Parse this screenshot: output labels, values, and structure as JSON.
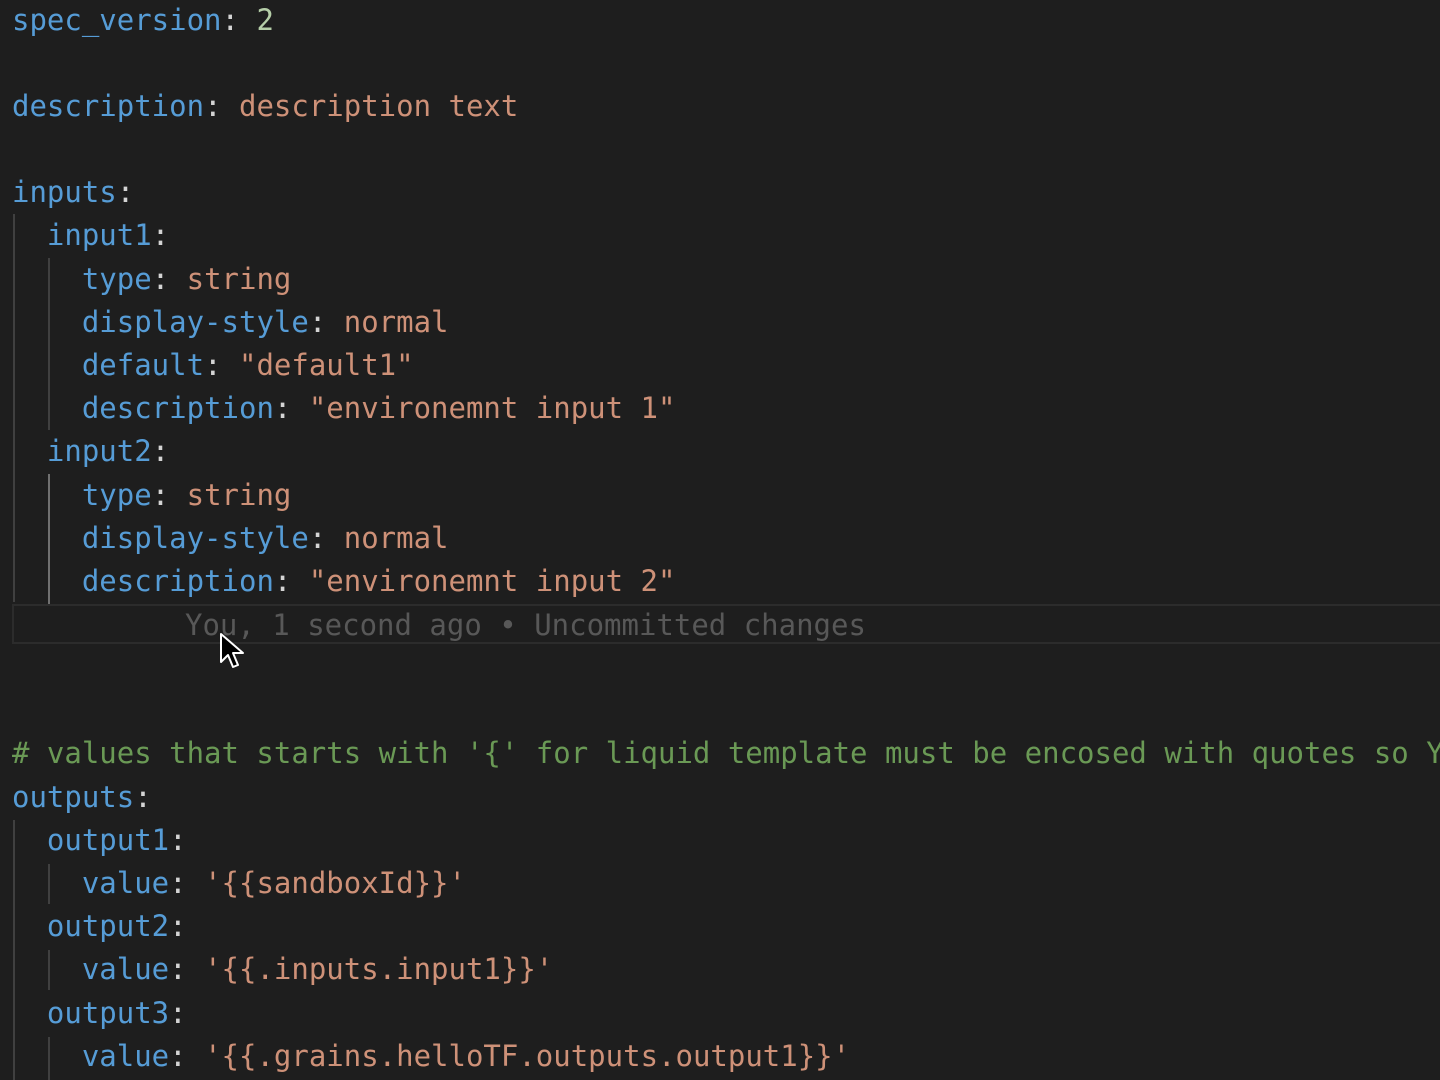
{
  "editor": {
    "language": "yaml",
    "lines": {
      "spec_version": {
        "key": "spec_version",
        "value": "2"
      },
      "description": {
        "key": "description",
        "value": "description text"
      },
      "inputs": {
        "key": "inputs"
      },
      "input1": {
        "key": "input1",
        "type": {
          "key": "type",
          "value": "string"
        },
        "display_style": {
          "key": "display-style",
          "value": "normal"
        },
        "default": {
          "key": "default",
          "value": "\"default1\""
        },
        "description": {
          "key": "description",
          "value": "\"environemnt input 1\""
        }
      },
      "input2": {
        "key": "input2",
        "type": {
          "key": "type",
          "value": "string"
        },
        "display_style": {
          "key": "display-style",
          "value": "normal"
        },
        "description": {
          "key": "description",
          "value": "\"environemnt input 2\""
        }
      },
      "comment": "# values that starts with '{' for liquid template must be encosed with quotes so YAML",
      "outputs": {
        "key": "outputs"
      },
      "output1": {
        "key": "output1",
        "value_key": "value",
        "value": "'{{sandboxId}}'"
      },
      "output2": {
        "key": "output2",
        "value_key": "value",
        "value": "'{{.inputs.input1}}'"
      },
      "output3": {
        "key": "output3",
        "value_key": "value",
        "value": "'{{.grains.helloTF.outputs.output1}}'"
      }
    },
    "blame": "You, 1 second ago • Uncommitted changes",
    "colors": {
      "background": "#1e1e1e",
      "key": "#569cd6",
      "string": "#ce9178",
      "number": "#b5cea8",
      "comment": "#6a9955",
      "punctuation": "#d4d4d4",
      "blame": "#585858"
    }
  }
}
